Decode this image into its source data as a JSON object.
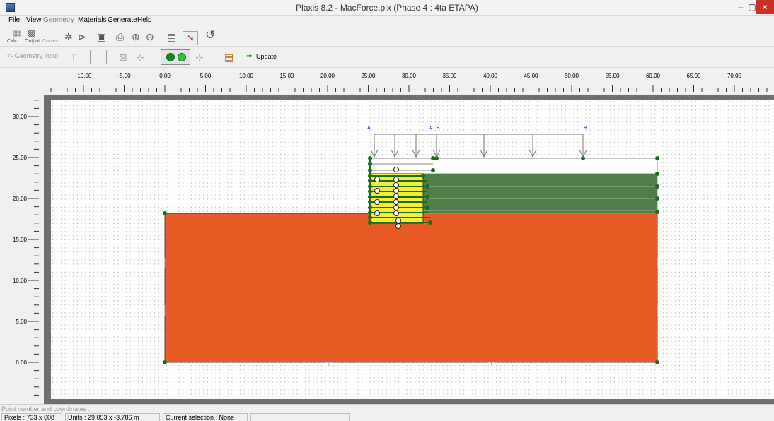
{
  "window": {
    "title": "Plaxis 8.2 - MacForce.plx (Phase 4 : 4ta ETAPA)",
    "minimize": "–",
    "maximize": "▢",
    "close": "×"
  },
  "menu": [
    "File",
    "View",
    "Geometry",
    "Materials",
    "Generate",
    "Help"
  ],
  "toolbar": {
    "calc_label": "Calc",
    "output_label": "Output",
    "curves_label": "Curves",
    "geometry_input_label": "<- Geometry input",
    "update_label": "Update"
  },
  "ruler": {
    "x_ticks": [
      "-10.00",
      "-5.00",
      "0.00",
      "5.00",
      "10.00",
      "15.00",
      "20.00",
      "25.00",
      "30.00",
      "35.00",
      "40.00",
      "45.00",
      "50.00",
      "55.00",
      "60.00",
      "65.00",
      "70.00"
    ],
    "y_ticks": [
      "30.00",
      "25.00",
      "20.00",
      "15.00",
      "10.00",
      "5.00",
      "0.00"
    ]
  },
  "model": {
    "load_labels": {
      "a_left": "A",
      "a_right": "A",
      "b_left": "B",
      "b_right": "B"
    },
    "colors": {
      "soil_base": "#e65a23",
      "soil_fill": "#4e7f47",
      "geogrid": "#f2ef3b",
      "node": "#1e6b1e",
      "load_label": "#2222cc"
    }
  },
  "status": {
    "line1": "Point number and coordinates :",
    "pixels": "Pixels : 733 x 608",
    "units": "Units : 29.053 x -3.786 m",
    "selection": "Current selection : None"
  }
}
